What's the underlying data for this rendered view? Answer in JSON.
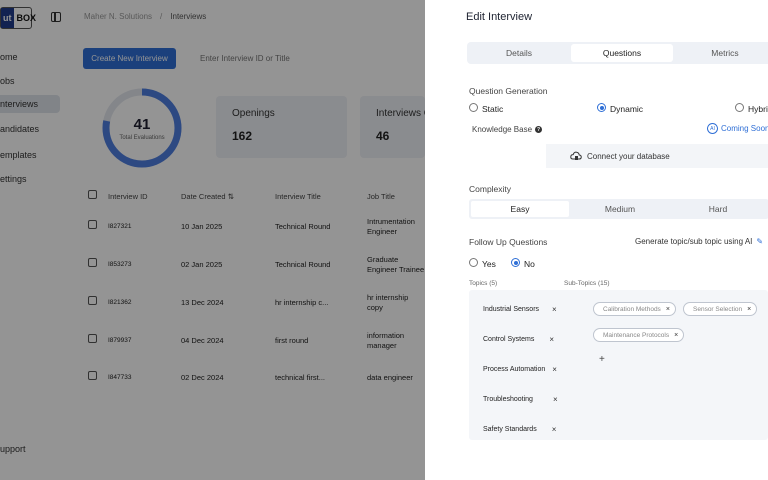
{
  "app": {
    "logo_left": "ut",
    "logo_right": "BOX",
    "breadcrumb": {
      "org": "Maher N. Solutions",
      "sep": "/",
      "current": "Interviews"
    },
    "nav": [
      "ome",
      "obs",
      "nterviews",
      "andidates",
      "emplates",
      "ettings"
    ],
    "support": "upport",
    "create_button": "Create New Interview",
    "search_placeholder": "Enter Interview ID or Title",
    "donut": {
      "value": "41",
      "label": "Total Evaluations",
      "fraction": 0.78
    },
    "stats": [
      {
        "title": "Openings",
        "value": "162"
      },
      {
        "title": "Interviews C",
        "value": "46"
      }
    ],
    "table": {
      "headers": [
        "Interview ID",
        "Date Created",
        "Interview Title",
        "Job Title"
      ],
      "rows": [
        {
          "id": "I827321",
          "date": "10 Jan 2025",
          "title": "Technical Round",
          "job": [
            "Intrumentation",
            "Engineer"
          ]
        },
        {
          "id": "I853273",
          "date": "02 Jan 2025",
          "title": "Technical Round",
          "job": [
            "Graduate",
            "Engineer Trainee"
          ]
        },
        {
          "id": "I821362",
          "date": "13 Dec 2024",
          "title": "hr internship c...",
          "job": [
            "hr internship",
            "copy"
          ]
        },
        {
          "id": "I879937",
          "date": "04 Dec 2024",
          "title": "first round",
          "job": [
            "information",
            "manager"
          ]
        },
        {
          "id": "I847733",
          "date": "02 Dec 2024",
          "title": "technical first...",
          "job": [
            "data engineer",
            ""
          ]
        }
      ]
    }
  },
  "drawer": {
    "title": "Edit Interview",
    "tabs": [
      "Details",
      "Questions",
      "Metrics"
    ],
    "active_tab": "Questions",
    "question_generation": {
      "label": "Question Generation",
      "options": [
        "Static",
        "Dynamic",
        "Hybri"
      ],
      "selected": "Dynamic"
    },
    "knowledge_base": {
      "label": "Knowledge Base",
      "coming_soon": "Coming Soon",
      "ai_badge": "AI",
      "connect": "Connect your database"
    },
    "complexity": {
      "label": "Complexity",
      "options": [
        "Easy",
        "Medium",
        "Hard"
      ],
      "selected": "Easy"
    },
    "follow_up": {
      "label": "Follow Up Questions",
      "options": [
        "Yes",
        "No"
      ],
      "selected": "No",
      "generate": "Generate topic/sub topic using AI"
    },
    "topics_label": "Topics (5)",
    "subtopics_label": "Sub-Topics (15)",
    "topics": [
      "Industrial Sensors",
      "Control Systems",
      "Process Automation",
      "Troubleshooting",
      "Safety Standards"
    ],
    "subtopics": [
      "Calibration Methods",
      "Sensor Selection",
      "Maintenance Protocols"
    ],
    "add_symbol": "+",
    "close_symbol": "×",
    "accent_color": "#2f6fd6"
  }
}
